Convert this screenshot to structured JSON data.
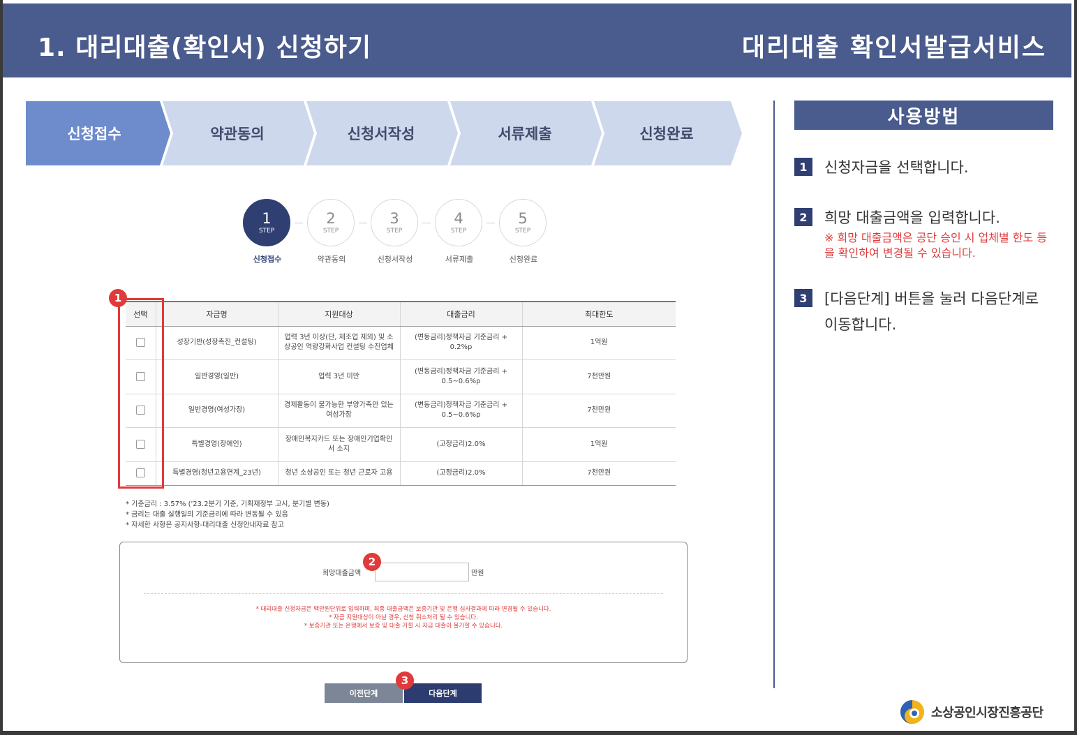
{
  "header": {
    "title": "1. 대리대출(확인서) 신청하기",
    "service": "대리대출 확인서발급서비스"
  },
  "progress": {
    "items": [
      {
        "label": "신청접수",
        "active": true
      },
      {
        "label": "약관동의",
        "active": false
      },
      {
        "label": "신청서작성",
        "active": false
      },
      {
        "label": "서류제출",
        "active": false
      },
      {
        "label": "신청완료",
        "active": false
      }
    ]
  },
  "steps": {
    "step_text": "STEP",
    "items": [
      {
        "num": "1",
        "caption": "신청접수"
      },
      {
        "num": "2",
        "caption": "약관동의"
      },
      {
        "num": "3",
        "caption": "신청서작성"
      },
      {
        "num": "4",
        "caption": "서류제출"
      },
      {
        "num": "5",
        "caption": "신청완료"
      }
    ],
    "current": 1
  },
  "table": {
    "headers": [
      "선택",
      "자금명",
      "지원대상",
      "대출금리",
      "최대한도"
    ],
    "rows": [
      {
        "name": "성장기반(성장촉진_컨설팅)",
        "target": "업력 3년 이상(단, 제조업 제외) 및 소상공인 역량강화사업 컨설팅 수진업체",
        "rate": "(변동금리)정책자금 기준금리 + 0.2%p",
        "limit": "1억원",
        "checked": false
      },
      {
        "name": "일반경영(일반)",
        "target": "업력 3년 미만",
        "rate": "(변동금리)정책자금 기준금리 + 0.5~0.6%p",
        "limit": "7천만원",
        "checked": false
      },
      {
        "name": "일반경영(여성가장)",
        "target": "경제활동이 불가능한 부양가족만 있는 여성가장",
        "rate": "(변동금리)정책자금 기준금리 + 0.5~0.6%p",
        "limit": "7천만원",
        "checked": false
      },
      {
        "name": "특별경영(장애인)",
        "target": "장애인복지카드 또는 장애인기업확인서 소지",
        "rate": "(고정금리)2.0%",
        "limit": "1억원",
        "checked": false
      },
      {
        "name": "특별경영(청년고용연계_23년)",
        "target": "청년 소상공인 또는 청년 근로자 고용",
        "rate": "(고정금리)2.0%",
        "limit": "7천만원",
        "checked": false
      }
    ]
  },
  "notes": [
    "* 기준금리 : 3.57% ('23.2분기 기준, 기획재정부 고시, 분기별 변동)",
    "* 금리는 대출 실행일의 기준금리에 따라 변동될 수 있음",
    "* 자세한 사항은 공지사항-대리대출 신청안내자료 참고"
  ],
  "amount": {
    "label": "희망대출금액",
    "value": "",
    "unit": "만원",
    "warnings": [
      "* 대리대출 신청자금은 백만원단위로 입력하며, 최종 대출금액은 보증기관 및 은행 심사결과에 따라 변경될 수 있습니다.",
      "* 자금 지원대상이 아닐 경우, 신청 취소처리 될 수 있습니다.",
      "* 보증기관 또는 은행에서 보증 및 대출 거절 시 자금 대출이 불가할 수 있습니다."
    ]
  },
  "buttons": {
    "prev": "이전단계",
    "next": "다음단계"
  },
  "badges": [
    "1",
    "2",
    "3"
  ],
  "usage": {
    "title": "사용방법",
    "items": [
      {
        "num": "1",
        "text": "신청자금을 선택합니다.",
        "sub": ""
      },
      {
        "num": "2",
        "text": "희망 대출금액을 입력합니다.",
        "sub": "※ 희망 대출금액은 공단 승인 시 업체별 한도 등을 확인하여 변경될 수 있습니다."
      },
      {
        "num": "3",
        "text": "[다음단계] 버튼을 눌러 다음단계로 이동합니다.",
        "sub": ""
      }
    ]
  },
  "logo": {
    "text": "소상공인시장진흥공단"
  },
  "colors": {
    "header": "#4a5b8d",
    "arrow_active": "#6e8ccc",
    "arrow_inactive": "#cdd8ec",
    "step_active": "#2f3f72",
    "accent_red": "#e03a3a",
    "button_next": "#2c3c70",
    "button_prev": "#7c8696"
  }
}
